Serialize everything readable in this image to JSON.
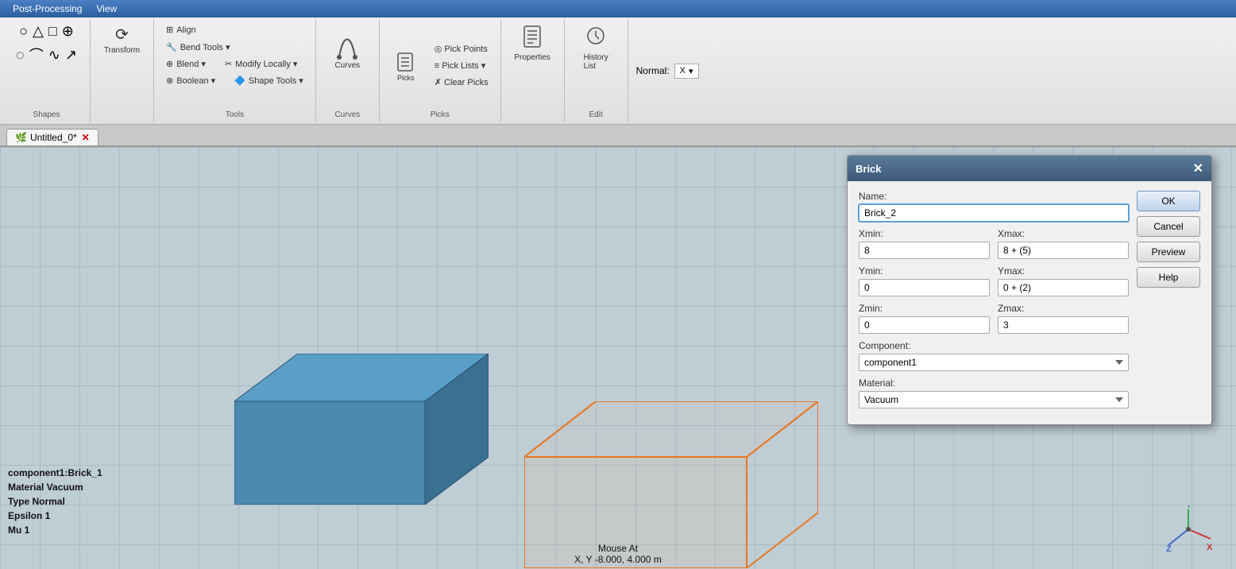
{
  "menubar": {
    "items": [
      "Post-Processing",
      "View"
    ]
  },
  "toolbar": {
    "shapes_label": "Shapes",
    "tools_label": "Tools",
    "curves_label": "Curves",
    "picks_label": "Picks",
    "edit_label": "Edit",
    "transform_label": "Transform",
    "align_label": "Align",
    "bend_tools_label": "Bend Tools ▾",
    "blend_label": "Blend ▾",
    "modify_locally_label": "Modify Locally ▾",
    "boolean_label": "Boolean ▾",
    "shape_tools_label": "Shape Tools ▾",
    "curves_btn_label": "Curves",
    "picks_btn_label": "Picks",
    "pick_points_label": "Pick Points",
    "pick_lists_label": "Pick Lists ▾",
    "clear_picks_label": "Clear Picks",
    "properties_label": "Properties",
    "history_list_label": "History\nList",
    "normal_label": "Normal:",
    "normal_axis": "X"
  },
  "tab": {
    "label": "Untitled_0*",
    "icon": "🌿",
    "close": "✕"
  },
  "dialog": {
    "title": "Brick",
    "close": "✕",
    "name_label": "Name:",
    "name_value": "Brick_2",
    "xmin_label": "Xmin:",
    "xmin_value": "8",
    "xmax_label": "Xmax:",
    "xmax_value": "8 + (5)",
    "ymin_label": "Ymin:",
    "ymin_value": "0",
    "ymax_label": "Ymax:",
    "ymax_value": "0 + (2)",
    "zmin_label": "Zmin:",
    "zmin_value": "0",
    "zmax_label": "Zmax:",
    "zmax_value": "3",
    "component_label": "Component:",
    "component_value": "component1",
    "material_label": "Material:",
    "material_value": "Vacuum",
    "ok_label": "OK",
    "cancel_label": "Cancel",
    "preview_label": "Preview",
    "help_label": "Help"
  },
  "status": {
    "line1": "component1:Brick_1",
    "line2": "Material   Vacuum",
    "line3": "Type        Normal",
    "line4": "Epsilon     1",
    "line5": "Mu          1"
  },
  "mouse": {
    "label": "Mouse At",
    "coords": "X, Y   -8.000,   4.000 m"
  }
}
